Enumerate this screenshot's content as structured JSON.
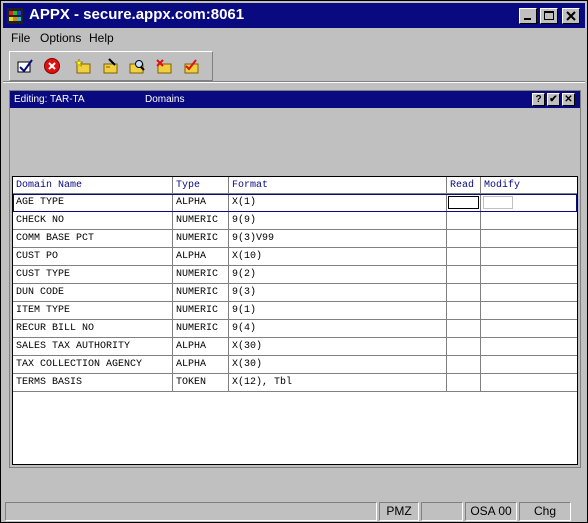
{
  "window": {
    "title": "APPX - secure.appx.com:8061",
    "controls": {
      "minimize": "minimize-icon",
      "maximize": "maximize-icon",
      "close": "close-icon"
    }
  },
  "menu": [
    "File",
    "Options",
    "Help"
  ],
  "toolbar": {
    "tools": [
      {
        "name": "ok-check-icon"
      },
      {
        "name": "cancel-icon"
      },
      {
        "name": "add-record-icon"
      },
      {
        "name": "change-record-icon"
      },
      {
        "name": "inquire-record-icon"
      },
      {
        "name": "delete-record-icon"
      },
      {
        "name": "select-record-icon"
      }
    ]
  },
  "editor": {
    "editing_label": "Editing: TAR-TA",
    "section": "Domains",
    "buttons": {
      "help": "?",
      "ok": "✔",
      "close": "✕"
    }
  },
  "table": {
    "headers": [
      "Domain Name",
      "Type",
      "Format",
      "Read",
      "Modify"
    ],
    "rows": [
      {
        "name": "AGE TYPE",
        "type": "ALPHA",
        "format": "X(1)"
      },
      {
        "name": "CHECK NO",
        "type": "NUMERIC",
        "format": "9(9)"
      },
      {
        "name": "COMM BASE PCT",
        "type": "NUMERIC",
        "format": "9(3)V99"
      },
      {
        "name": "CUST PO",
        "type": "ALPHA",
        "format": "X(10)"
      },
      {
        "name": "CUST TYPE",
        "type": "NUMERIC",
        "format": "9(2)"
      },
      {
        "name": "DUN CODE",
        "type": "NUMERIC",
        "format": "9(3)"
      },
      {
        "name": "ITEM TYPE",
        "type": "NUMERIC",
        "format": "9(1)"
      },
      {
        "name": "RECUR BILL NO",
        "type": "NUMERIC",
        "format": "9(4)"
      },
      {
        "name": "SALES TAX AUTHORITY",
        "type": "ALPHA",
        "format": "X(30)"
      },
      {
        "name": "TAX COLLECTION AGENCY",
        "type": "ALPHA",
        "format": "X(30)"
      },
      {
        "name": "TERMS BASIS",
        "type": "TOKEN",
        "format": "X(12), Tbl"
      }
    ]
  },
  "status": {
    "fields": [
      "",
      "PMZ",
      "",
      "OSA 00",
      "Chg"
    ]
  },
  "colors": {
    "title_bg": "#0a0a80",
    "face": "#c0c0c0",
    "header_text": "#0a0a80",
    "selection_border": "#0a0a80"
  }
}
